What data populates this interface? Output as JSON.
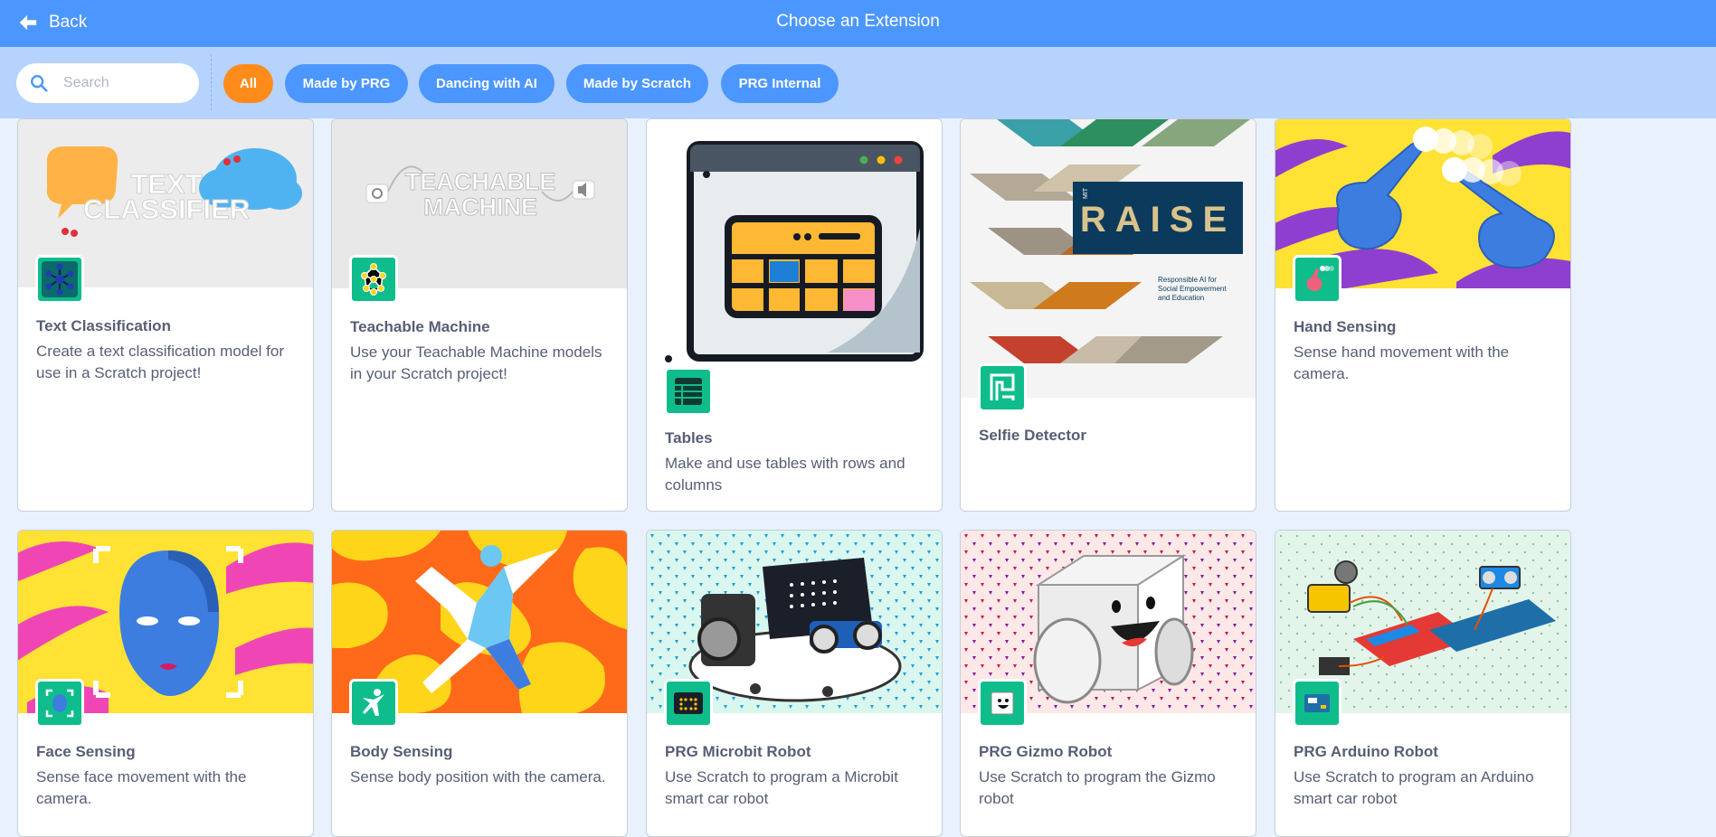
{
  "header": {
    "back_label": "Back",
    "title": "Choose an Extension"
  },
  "search": {
    "placeholder": "Search",
    "value": ""
  },
  "filters": [
    {
      "label": "All",
      "active": true
    },
    {
      "label": "Made by PRG",
      "active": false
    },
    {
      "label": "Dancing with AI",
      "active": false
    },
    {
      "label": "Made by Scratch",
      "active": false
    },
    {
      "label": "PRG Internal",
      "active": false
    }
  ],
  "art_text": {
    "text_classifier": [
      "TEXT",
      "CLASSIFIER"
    ],
    "teachable_machine": [
      "TEACHABLE",
      "MACHINE"
    ],
    "raise_logo": "RAISE",
    "raise_mit": "MIT",
    "raise_tagline": [
      "Responsible AI for",
      "Social Empowerment",
      "and Education"
    ]
  },
  "extensions": [
    {
      "name": "Text Classification",
      "description": "Create a text classification model for use in a Scratch project!"
    },
    {
      "name": "Teachable Machine",
      "description": "Use your Teachable Machine models in your Scratch project!"
    },
    {
      "name": "Tables",
      "description": "Make and use tables with rows and columns"
    },
    {
      "name": "Selfie Detector",
      "description": ""
    },
    {
      "name": "Hand Sensing",
      "description": "Sense hand movement with the camera."
    },
    {
      "name": "Face Sensing",
      "description": "Sense face movement with the camera."
    },
    {
      "name": "Body Sensing",
      "description": "Sense body position with the camera."
    },
    {
      "name": "PRG Microbit Robot",
      "description": "Use Scratch to program a Microbit smart car robot"
    },
    {
      "name": "PRG Gizmo Robot",
      "description": "Use Scratch to program the Gizmo robot"
    },
    {
      "name": "PRG Arduino Robot",
      "description": "Use Scratch to program an Arduino smart car robot"
    }
  ],
  "colors": {
    "header": "#4c97ff",
    "filterbar": "#b5d3fd",
    "active_chip": "#ff8c1a",
    "chip": "#4c97ff",
    "icon_bg": "#0fbd8c"
  }
}
